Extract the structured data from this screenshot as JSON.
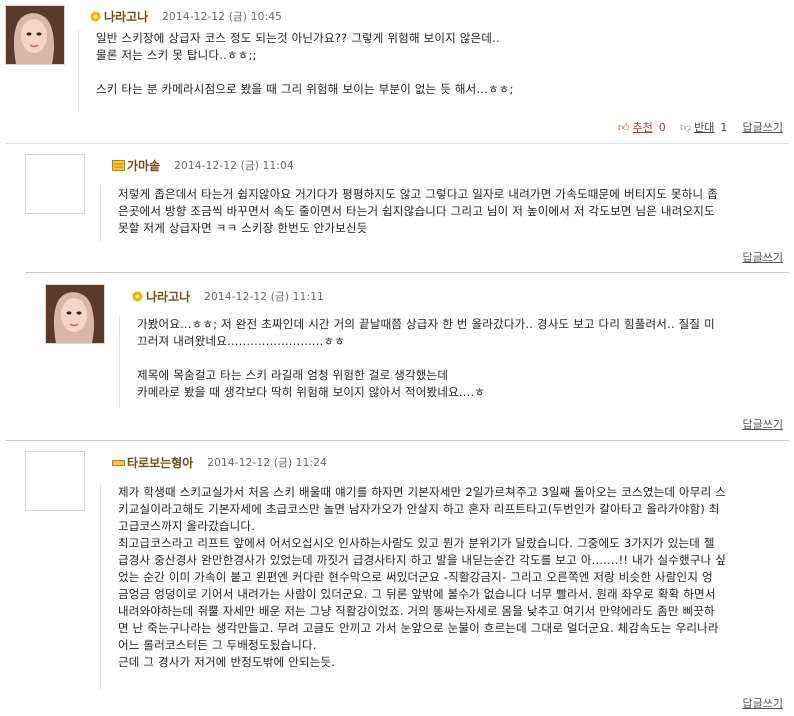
{
  "comments": [
    {
      "nickname": "나라고나",
      "date": "2014-12-12 (금) 10:45",
      "lines": [
        "일반 스키장에 상급자 코스 정도 되는것 아닌가요?? 그렇게 위험해 보이지 않은데..",
        "물론 저는 스키 못 탑니다..ㅎㅎ;;",
        "",
        "스키 타는 분 카메라시점으로 봤을 때 그리 위험해 보이는 부분이 없는 듯 해서...ㅎㅎ;"
      ],
      "recommend_label": "추천",
      "recommend_count": "0",
      "oppose_label": "반대",
      "oppose_count": "1",
      "reply_label": "답글쓰기"
    },
    {
      "nickname": "가마솥",
      "date": "2014-12-12 (금) 11:04",
      "lines": [
        "저렇게 좁은데서 타는거 쉽지않아요 거기다가 평평하지도 않고 그렇다고 일자로 내려가면 가속도때문에 버티지도 못하니 좁",
        "은곳에서 방향 조금씩 바꾸면서 속도 줄이면서 타는거 쉽지않습니다 그리고 님이 저 높이에서 저 각도보면 님은 내려오지도",
        "못할 저게 상급자면 ㅋㅋ 스키장 한번도 안가보신듯"
      ],
      "reply_label": "답글쓰기"
    },
    {
      "nickname": "나라고나",
      "date": "2014-12-12 (금) 11:11",
      "lines": [
        "가봤어요...ㅎㅎ;  저 완전 초짜인데 시간 거의 끝날때쯤 상급자 한 번 올라갔다가.. 경사도 보고 다리 힘풀려서.. 질질 미",
        "끄러져 내려왔네요.........................ㅎㅎ",
        "",
        "제목에 목숨걸고 타는 스키 라길래 엄청 위험한 걸로 생각했는데",
        "카메라로 봤을 때 생각보다 딱히 위험해 보이지 않아서 적어봤네요....ㅎ"
      ],
      "reply_label": "답글쓰기"
    },
    {
      "nickname": "타로보는형아",
      "date": "2014-12-12 (금) 11:24",
      "lines": [
        "제가 학생때 스키교실가서 처음 스키 배울때 얘기를 하자면 기본자세만 2일가르쳐주고 3일째 돌아오는 코스였는데 아무리 스",
        "키교실이라고해도 기본자세에 초급코스만 놀면 남자가오가 안살지 하고 혼자 리프트타고(두번인가 갈아타고 올라가야함) 최",
        "고급코스까지 올라갔습니다.",
        " 최고급코스라고 리프트 앞에서 어서오십시오 인사하는사람도 있고 뭔가 분위기가 달랐습니다. 그중에도 3가지가 있는데 젤",
        "급경사 중산경사 완만한경사가 있었는데 까짓거 급경사타지 하고 발을 내딛는순간 각도를 보고 아.......!! 내가 실수했구나 싶",
        "었는 순간 이미 가속이 붙고 왼편엔 커다란 현수막으로 써있더군요 -직활강금지- 그리고 오른쪽엔 저랑 비슷한 사람인지 엉",
        "금엉금 엉덩이로 기어서 내려가는 사람이 있더군요. 그 뒤론 앞밖에 볼수가 없습니다 너무 빨라서. 원래 좌우로 확확 하면서",
        "내려와야하는데 쥐뿔 자세만 배운 저는 그냥 직활강이었죠. 거의 똥싸는자세로 몸을 낮추고 여기서 만약에라도 좀만 삐끗하",
        "면 난 죽는구나라는 생각만들고. 무려 고글도 안끼고 가서 눈앞으로 눈물이 흐르는데 그대로 얼더군요. 체감속도는 우리나라",
        "어느 롤러코스터든 그 두배정도됬습니다.",
        "근데 그 경사가 저거에 반정도밖에 안되는듯."
      ],
      "reply_label": "답글쓰기"
    }
  ],
  "colors": {
    "nickname": "#7a4a1a",
    "recommend": "#c0392b",
    "background": "#ffffff"
  }
}
